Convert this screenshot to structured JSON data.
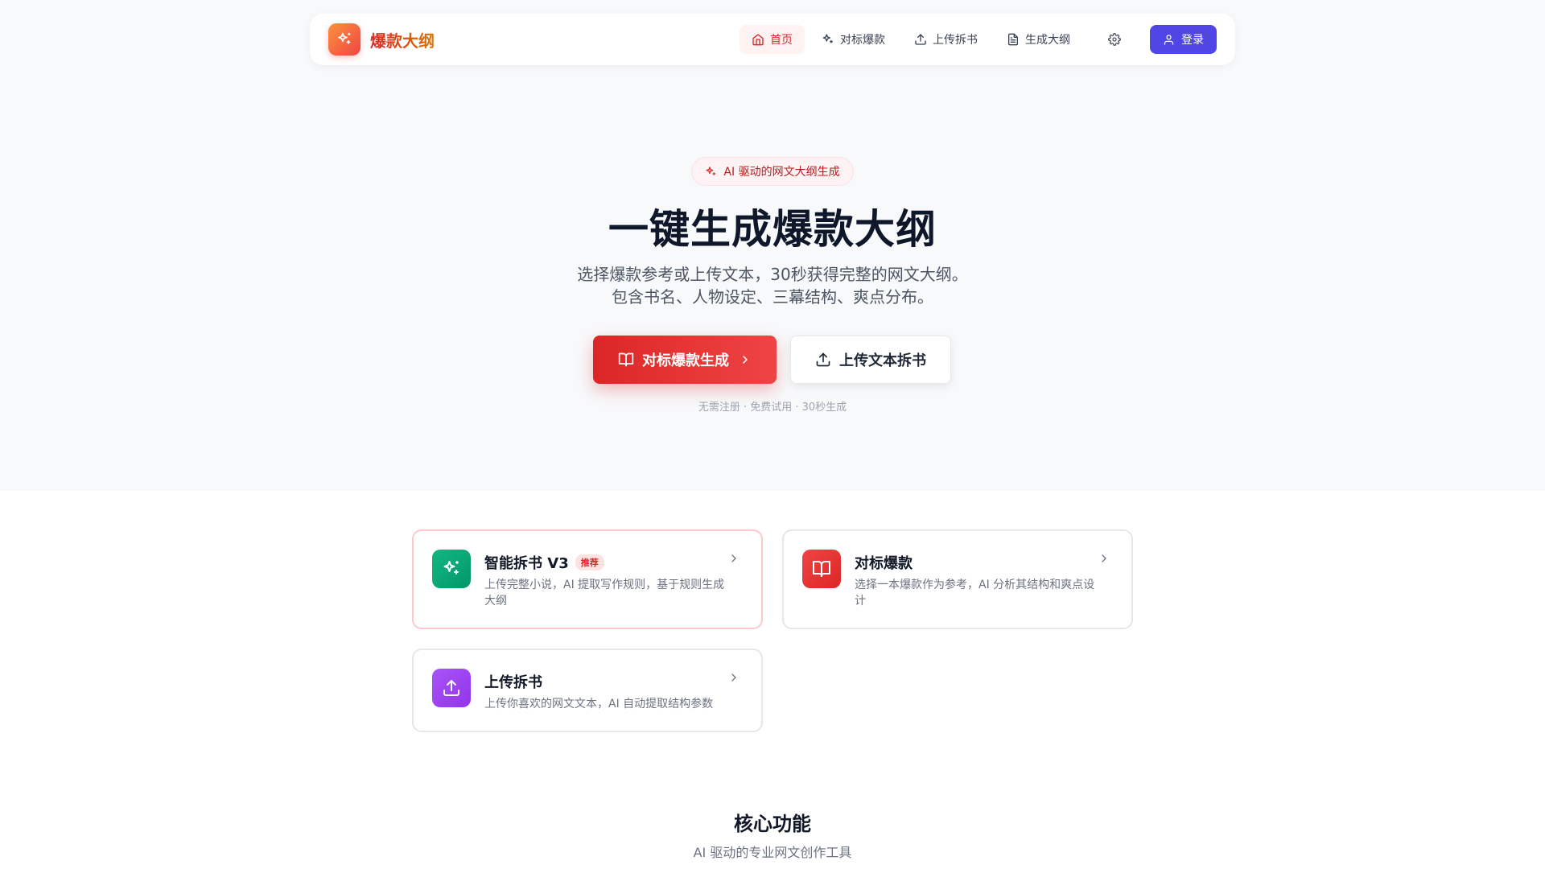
{
  "nav": {
    "logo_icon": "sparkles-icon",
    "brand": "爆款大纲",
    "items": [
      {
        "label": "首页",
        "icon": "home-icon",
        "active": true
      },
      {
        "label": "对标爆款",
        "icon": "sparkles-icon",
        "active": false
      },
      {
        "label": "上传拆书",
        "icon": "upload-icon",
        "active": false
      },
      {
        "label": "生成大纲",
        "icon": "file-text-icon",
        "active": false
      }
    ],
    "settings_icon": "gear-icon",
    "login": "登录",
    "login_icon": "user-icon"
  },
  "hero": {
    "badge": "AI 驱动的网文大纲生成",
    "title": "一键生成爆款大纲",
    "subtitle_line1": "选择爆款参考或上传文本，30秒获得完整的网文大纲。",
    "subtitle_line2": "包含书名、人物设定、三幕结构、爽点分布。",
    "primary_button": "对标爆款生成",
    "secondary_button": "上传文本拆书",
    "note": "无需注册 · 免费试用 · 30秒生成"
  },
  "cards": [
    {
      "title": "智能拆书 V3",
      "tag": "推荐",
      "desc": "上传完整小说，AI 提取写作规则，基于规则生成大纲",
      "icon": "sparkles-icon",
      "color": "#10b981"
    },
    {
      "title": "对标爆款",
      "desc": "选择一本爆款作为参考，AI 分析其结构和爽点设计",
      "icon": "book-open-icon",
      "color": "#ef4444"
    },
    {
      "title": "上传拆书",
      "desc": "上传你喜欢的网文文本，AI 自动提取结构参数",
      "icon": "upload-icon",
      "color": "#a855f7"
    }
  ],
  "section": {
    "title": "核心功能",
    "subtitle": "AI 驱动的专业网文创作工具"
  },
  "colors": {
    "accent_red": "#dc2626",
    "login_indigo": "#4f46e5"
  }
}
